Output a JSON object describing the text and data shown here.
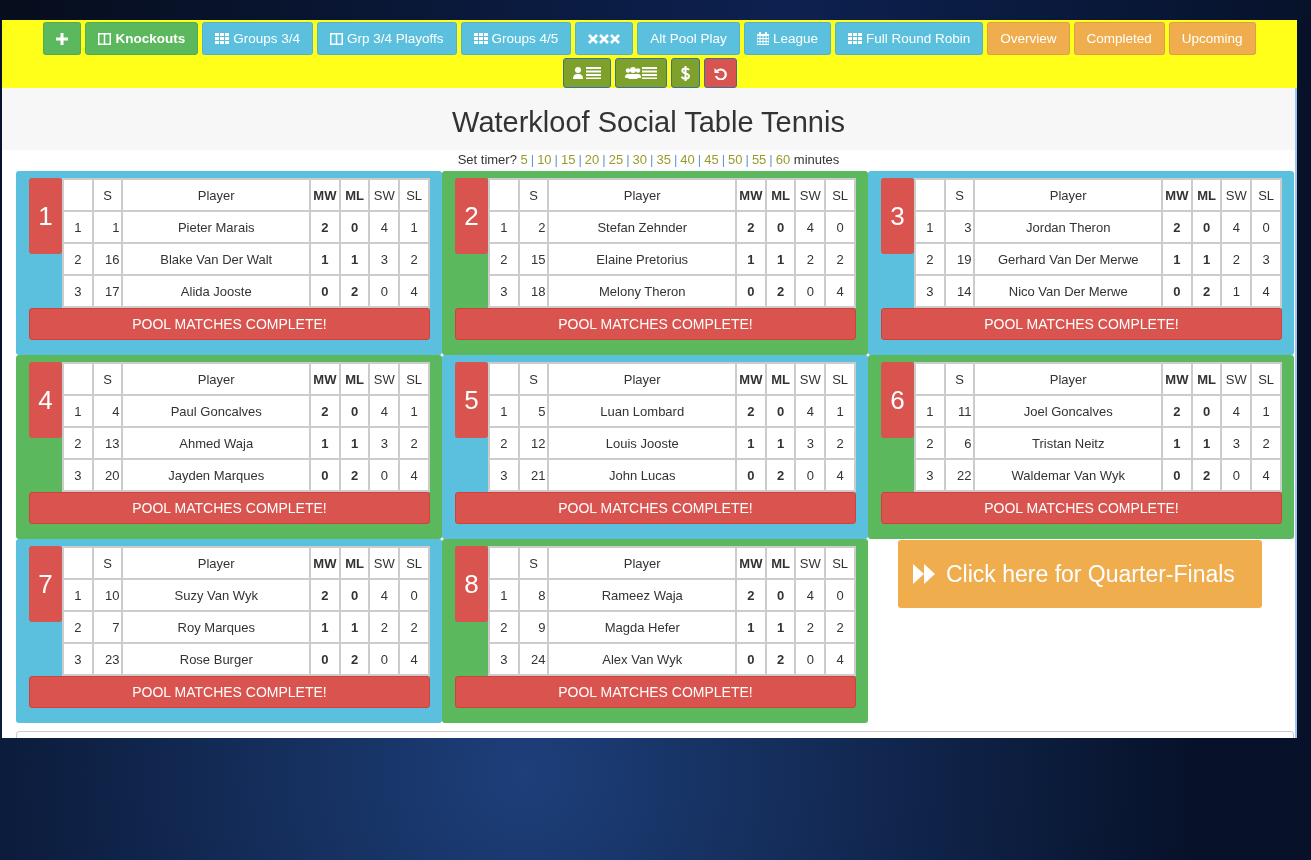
{
  "toolbar": [
    {
      "color": "#5cb85c",
      "selected": false
    },
    {
      "label": "Knockouts",
      "color": "#5cb85c",
      "selected": true
    },
    {
      "label": "Groups 3/4",
      "color": "#5bc0de",
      "selected": false
    },
    {
      "label": "Grp 3/4 Playoffs",
      "color": "#5bc0de",
      "selected": false
    },
    {
      "label": "Groups 4/5",
      "color": "#5bc0de",
      "selected": false
    },
    {
      "color": "#5bc0de",
      "selected": false
    },
    {
      "label": "Alt Pool Play",
      "color": "#5bc0de",
      "selected": false
    },
    {
      "label": "League",
      "color": "#5bc0de",
      "selected": false
    },
    {
      "label": "Full Round Robin",
      "color": "#5bc0de",
      "selected": false
    },
    {
      "label": "Overview",
      "color": "#f0ad4e",
      "selected": false
    },
    {
      "label": "Completed",
      "color": "#f0ad4e",
      "selected": false
    },
    {
      "label": "Upcoming",
      "color": "#f0ad4e",
      "selected": false
    }
  ],
  "toolbar_row_2": [
    {
      "color": "#7da12a"
    },
    {
      "color": "#7da12a"
    },
    {
      "color": "#7da12a"
    },
    {
      "color": "#d9534f"
    }
  ],
  "title": "Waterkloof Social Table Tennis",
  "timer": {
    "prompt": "Set timer?",
    "options": [
      "5",
      "10",
      "15",
      "20",
      "25",
      "30",
      "35",
      "40",
      "45",
      "50",
      "55",
      "60"
    ],
    "separator": "|",
    "suffix": "minutes"
  },
  "pools": [
    {
      "number": "1",
      "color": "#5bc0de",
      "columns": [
        "",
        "S",
        "Player",
        "MW",
        "ML",
        "SW",
        "SL"
      ],
      "rows": [
        [
          "1",
          "1",
          "Pieter Marais",
          "2",
          "0",
          "4",
          "1"
        ],
        [
          "2",
          "16",
          "Blake Van Der Walt",
          "1",
          "1",
          "3",
          "2"
        ],
        [
          "3",
          "17",
          "Alida Jooste",
          "0",
          "2",
          "0",
          "4"
        ]
      ],
      "status": "POOL MATCHES COMPLETE!"
    },
    {
      "number": "2",
      "color": "#5cb85c",
      "columns": [
        "",
        "S",
        "Player",
        "MW",
        "ML",
        "SW",
        "SL"
      ],
      "rows": [
        [
          "1",
          "2",
          "Stefan Zehnder",
          "2",
          "0",
          "4",
          "0"
        ],
        [
          "2",
          "15",
          "Elaine Pretorius",
          "1",
          "1",
          "2",
          "2"
        ],
        [
          "3",
          "18",
          "Melony Theron",
          "0",
          "2",
          "0",
          "4"
        ]
      ],
      "status": "POOL MATCHES COMPLETE!"
    },
    {
      "number": "3",
      "color": "#5bc0de",
      "columns": [
        "",
        "S",
        "Player",
        "MW",
        "ML",
        "SW",
        "SL"
      ],
      "rows": [
        [
          "1",
          "3",
          "Jordan Theron",
          "2",
          "0",
          "4",
          "0"
        ],
        [
          "2",
          "19",
          "Gerhard Van Der Merwe",
          "1",
          "1",
          "2",
          "3"
        ],
        [
          "3",
          "14",
          "Nico Van Der Merwe",
          "0",
          "2",
          "1",
          "4"
        ]
      ],
      "status": "POOL MATCHES COMPLETE!"
    },
    {
      "number": "4",
      "color": "#5cb85c",
      "columns": [
        "",
        "S",
        "Player",
        "MW",
        "ML",
        "SW",
        "SL"
      ],
      "rows": [
        [
          "1",
          "4",
          "Paul Goncalves",
          "2",
          "0",
          "4",
          "1"
        ],
        [
          "2",
          "13",
          "Ahmed Waja",
          "1",
          "1",
          "3",
          "2"
        ],
        [
          "3",
          "20",
          "Jayden Marques",
          "0",
          "2",
          "0",
          "4"
        ]
      ],
      "status": "POOL MATCHES COMPLETE!"
    },
    {
      "number": "5",
      "color": "#5bc0de",
      "columns": [
        "",
        "S",
        "Player",
        "MW",
        "ML",
        "SW",
        "SL"
      ],
      "rows": [
        [
          "1",
          "5",
          "Luan Lombard",
          "2",
          "0",
          "4",
          "1"
        ],
        [
          "2",
          "12",
          "Louis Jooste",
          "1",
          "1",
          "3",
          "2"
        ],
        [
          "3",
          "21",
          "John Lucas",
          "0",
          "2",
          "0",
          "4"
        ]
      ],
      "status": "POOL MATCHES COMPLETE!"
    },
    {
      "number": "6",
      "color": "#5cb85c",
      "columns": [
        "",
        "S",
        "Player",
        "MW",
        "ML",
        "SW",
        "SL"
      ],
      "rows": [
        [
          "1",
          "11",
          "Joel Goncalves",
          "2",
          "0",
          "4",
          "1"
        ],
        [
          "2",
          "6",
          "Tristan Neitz",
          "1",
          "1",
          "3",
          "2"
        ],
        [
          "3",
          "22",
          "Waldemar Van Wyk",
          "0",
          "2",
          "0",
          "4"
        ]
      ],
      "status": "POOL MATCHES COMPLETE!"
    },
    {
      "number": "7",
      "color": "#5bc0de",
      "columns": [
        "",
        "S",
        "Player",
        "MW",
        "ML",
        "SW",
        "SL"
      ],
      "rows": [
        [
          "1",
          "10",
          "Suzy Van Wyk",
          "2",
          "0",
          "4",
          "0"
        ],
        [
          "2",
          "7",
          "Roy Marques",
          "1",
          "1",
          "2",
          "2"
        ],
        [
          "3",
          "23",
          "Rose Burger",
          "0",
          "2",
          "0",
          "4"
        ]
      ],
      "status": "POOL MATCHES COMPLETE!"
    },
    {
      "number": "8",
      "color": "#5cb85c",
      "columns": [
        "",
        "S",
        "Player",
        "MW",
        "ML",
        "SW",
        "SL"
      ],
      "rows": [
        [
          "1",
          "8",
          "Rameez Waja",
          "2",
          "0",
          "4",
          "0"
        ],
        [
          "2",
          "9",
          "Magda Hefer",
          "1",
          "1",
          "2",
          "2"
        ],
        [
          "3",
          "24",
          "Alex Van Wyk",
          "0",
          "2",
          "0",
          "4"
        ]
      ],
      "status": "POOL MATCHES COMPLETE!"
    }
  ],
  "next_round_button": {
    "label": "Click here for Quarter-Finals"
  }
}
